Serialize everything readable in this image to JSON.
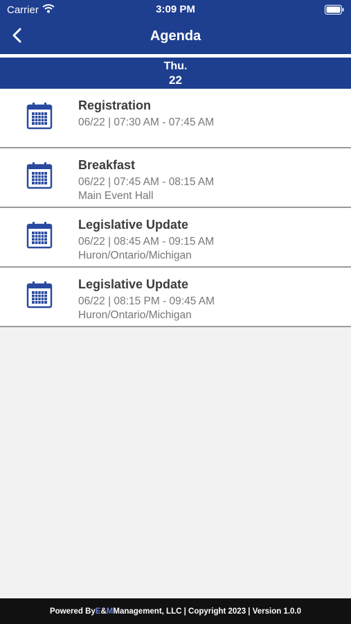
{
  "status_bar": {
    "carrier": "Carrier",
    "time": "3:09 PM"
  },
  "nav": {
    "title": "Agenda",
    "back_icon": "chevron-left-icon"
  },
  "date_header": {
    "day_of_week": "Thu.",
    "day": "22"
  },
  "agenda": {
    "items": [
      {
        "title": "Registration",
        "time": "06/22 | 07:30 AM - 07:45 AM",
        "location": ""
      },
      {
        "title": "Breakfast",
        "time": "06/22 | 07:45 AM - 08:15 AM",
        "location": "Main Event Hall"
      },
      {
        "title": "Legislative Update",
        "time": "06/22 | 08:45 AM - 09:15 AM",
        "location": "Huron/Ontario/Michigan"
      },
      {
        "title": "Legislative Update",
        "time": "06/22 | 08:15 PM - 09:45 AM",
        "location": "Huron/Ontario/Michigan"
      }
    ]
  },
  "footer": {
    "prefix": "Powered By ",
    "e": "E",
    "amp": "&",
    "m": "M",
    "suffix": " Management, LLC | Copyright 2023 | Version 1.0.0"
  },
  "colors": {
    "brand_blue": "#1e3f8f",
    "footer_bg": "#111111",
    "accent": "#6b7fd6"
  }
}
